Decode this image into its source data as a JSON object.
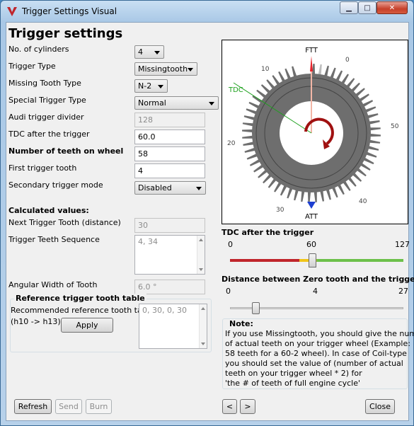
{
  "window": {
    "title": "Trigger Settings Visual",
    "minimize": "▁",
    "maximize": "□",
    "close": "✕"
  },
  "heading": "Trigger settings",
  "fields": {
    "cylinders_label": "No. of cylinders",
    "cylinders_value": "4",
    "trigger_type_label": "Trigger Type",
    "trigger_type_value": "Missingtooth",
    "missing_tooth_label": "Missing Tooth Type",
    "missing_tooth_value": "N-2",
    "special_trigger_label": "Special Trigger Type",
    "special_trigger_value": "Normal",
    "audi_divider_label": "Audi trigger divider",
    "audi_divider_value": "128",
    "tdc_after_label": "TDC after the trigger",
    "tdc_after_value": "60.0",
    "teeth_label": "Number of teeth on wheel",
    "teeth_value": "58",
    "first_tooth_label": "First trigger tooth",
    "first_tooth_value": "4",
    "secondary_label": "Secondary trigger mode",
    "secondary_value": "Disabled"
  },
  "calculated": {
    "heading": "Calculated values:",
    "next_label": "Next Trigger Tooth (distance)",
    "next_value": "30",
    "sequence_label": "Trigger Teeth Sequence",
    "sequence_value": "4, 34",
    "angular_label": "Angular Width of Tooth",
    "angular_value": "6.0 °"
  },
  "reference": {
    "heading": "Reference trigger tooth table",
    "recommended_label": "Recommended reference tooth table",
    "range_label": "(h10 -> h13)",
    "apply": "Apply",
    "table_value": "0, 30, 0, 30"
  },
  "wheel": {
    "ftt": "FTT",
    "att": "ATT",
    "tdc": "TDC",
    "ticks": [
      "0",
      "10",
      "20",
      "30",
      "40",
      "50"
    ],
    "teeth": 58,
    "missing": 2,
    "tdc_angle": 60
  },
  "tdc_slider": {
    "title": "TDC after the trigger",
    "min": "0",
    "mid": "60",
    "max": "127",
    "value": 60,
    "range_max": 127
  },
  "distance_slider": {
    "title": "Distance between Zero tooth and the trigger",
    "min": "0",
    "mid": "4",
    "max": "27",
    "value": 4,
    "range_max": 27
  },
  "note": {
    "title": "Note:",
    "lines": [
      "If you use Missingtooth, you should give the number",
      "of actual teeth on your trigger wheel (Example:",
      "58 teeth for a 60-2 wheel). In case of Coil-type",
      "you should set the value of (number of actual",
      "teeth on your trigger wheel * 2) for",
      "'the # of teeth of full engine cycle'"
    ]
  },
  "buttons": {
    "refresh": "Refresh",
    "send": "Send",
    "burn": "Burn",
    "prev": "<",
    "next": ">",
    "close": "Close"
  },
  "colors": {
    "accent_red": "#c0252b",
    "tdc_green": "#1ea11e",
    "ftt_red": "#e8232b",
    "att_blue": "#1d3fd1"
  }
}
